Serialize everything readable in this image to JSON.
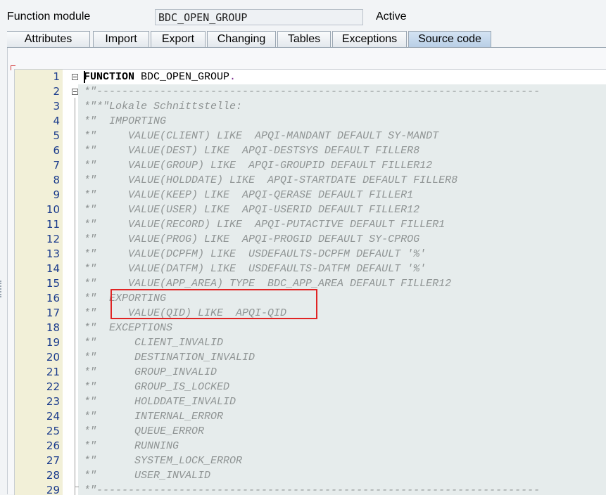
{
  "header": {
    "label": "Function module",
    "name_value": "BDC_OPEN_GROUP",
    "status": "Active"
  },
  "tabs": [
    {
      "label": "Attributes",
      "active": false
    },
    {
      "label": "Import",
      "active": false
    },
    {
      "label": "Export",
      "active": false
    },
    {
      "label": "Changing",
      "active": false
    },
    {
      "label": "Tables",
      "active": false
    },
    {
      "label": "Exceptions",
      "active": false
    },
    {
      "label": "Source code",
      "active": true
    }
  ],
  "colors": {
    "gutter": "#f2f0d8",
    "code_background": "#e6ecec",
    "comment": "#8f9494",
    "line_number": "#1a3b8c",
    "active_tab": "#c6d9ee",
    "highlight_border": "#e02424"
  },
  "editor": {
    "lines": [
      {
        "n": "1",
        "keyword": "FUNCTION",
        "rest": " BDC_OPEN_GROUP",
        "dot": ".",
        "type": "code"
      },
      {
        "n": "2",
        "text": "*\"----------------------------------------------------------------------",
        "type": "comment"
      },
      {
        "n": "3",
        "text": "*\"*\"Lokale Schnittstelle:",
        "type": "comment"
      },
      {
        "n": "4",
        "text": "*\"  IMPORTING",
        "type": "comment"
      },
      {
        "n": "5",
        "text": "*\"     VALUE(CLIENT) LIKE  APQI-MANDANT DEFAULT SY-MANDT",
        "type": "comment"
      },
      {
        "n": "6",
        "text": "*\"     VALUE(DEST) LIKE  APQI-DESTSYS DEFAULT FILLER8",
        "type": "comment"
      },
      {
        "n": "7",
        "text": "*\"     VALUE(GROUP) LIKE  APQI-GROUPID DEFAULT FILLER12",
        "type": "comment"
      },
      {
        "n": "8",
        "text": "*\"     VALUE(HOLDDATE) LIKE  APQI-STARTDATE DEFAULT FILLER8",
        "type": "comment"
      },
      {
        "n": "9",
        "text": "*\"     VALUE(KEEP) LIKE  APQI-QERASE DEFAULT FILLER1",
        "type": "comment"
      },
      {
        "n": "10",
        "text": "*\"     VALUE(USER) LIKE  APQI-USERID DEFAULT FILLER12",
        "type": "comment"
      },
      {
        "n": "11",
        "text": "*\"     VALUE(RECORD) LIKE  APQI-PUTACTIVE DEFAULT FILLER1",
        "type": "comment"
      },
      {
        "n": "12",
        "text": "*\"     VALUE(PROG) LIKE  APQI-PROGID DEFAULT SY-CPROG",
        "type": "comment"
      },
      {
        "n": "13",
        "text": "*\"     VALUE(DCPFM) LIKE  USDEFAULTS-DCPFM DEFAULT '%'",
        "type": "comment"
      },
      {
        "n": "14",
        "text": "*\"     VALUE(DATFM) LIKE  USDEFAULTS-DATFM DEFAULT '%'",
        "type": "comment"
      },
      {
        "n": "15",
        "text": "*\"     VALUE(APP_AREA) TYPE  BDC_APP_AREA DEFAULT FILLER12",
        "type": "comment"
      },
      {
        "n": "16",
        "text": "*\"  EXPORTING",
        "type": "comment"
      },
      {
        "n": "17",
        "text": "*\"     VALUE(QID) LIKE  APQI-QID",
        "type": "comment"
      },
      {
        "n": "18",
        "text": "*\"  EXCEPTIONS",
        "type": "comment"
      },
      {
        "n": "19",
        "text": "*\"      CLIENT_INVALID",
        "type": "comment"
      },
      {
        "n": "20",
        "text": "*\"      DESTINATION_INVALID",
        "type": "comment"
      },
      {
        "n": "21",
        "text": "*\"      GROUP_INVALID",
        "type": "comment"
      },
      {
        "n": "22",
        "text": "*\"      GROUP_IS_LOCKED",
        "type": "comment"
      },
      {
        "n": "23",
        "text": "*\"      HOLDDATE_INVALID",
        "type": "comment"
      },
      {
        "n": "24",
        "text": "*\"      INTERNAL_ERROR",
        "type": "comment"
      },
      {
        "n": "25",
        "text": "*\"      QUEUE_ERROR",
        "type": "comment"
      },
      {
        "n": "26",
        "text": "*\"      RUNNING",
        "type": "comment"
      },
      {
        "n": "27",
        "text": "*\"      SYSTEM_LOCK_ERROR",
        "type": "comment"
      },
      {
        "n": "28",
        "text": "*\"      USER_INVALID",
        "type": "comment"
      },
      {
        "n": "29",
        "text": "*\"----------------------------------------------------------------------",
        "type": "comment"
      }
    ]
  }
}
